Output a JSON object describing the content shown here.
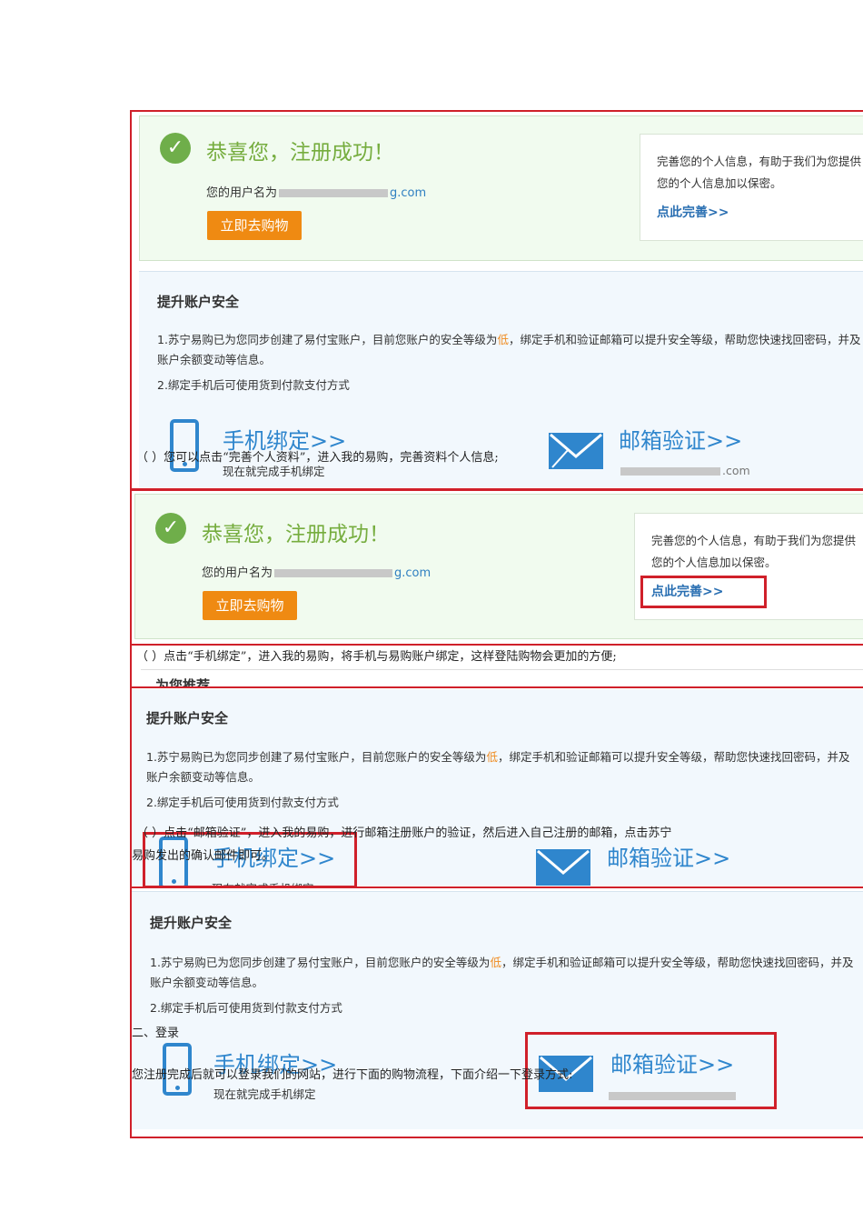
{
  "success": {
    "title": "恭喜您，注册成功！",
    "username_label": "您的用户名为",
    "username_suffix": "g.com",
    "shop_button": "立即去购物",
    "info_line1": "完善您的个人信息，有助于我们为您提供",
    "info_line2": "您的个人信息加以保密。",
    "complete_link": "点此完善>>"
  },
  "security": {
    "heading": "提升账户安全",
    "line1_a": "1.苏宁易购已为您同步创建了易付宝账户，目前您账户的安全等级为",
    "line1_low": "低",
    "line1_b": "，绑定手机和验证邮箱可以提升安全等级，帮助您快速找回密码，并及",
    "line1_cont": "账户余额变动等信息。",
    "line2": "2.绑定手机后可使用货到付款支付方式",
    "phone_bind": "手机绑定>>",
    "phone_sub": "现在就完成手机绑定",
    "email_verify": "邮箱验证>>",
    "email_suffix": ".com"
  },
  "recommend": "为您推荐",
  "doc": {
    "step_profile": "（ ）您可以点击“完善个人资料”，进入我的易购，完善资料个人信息;",
    "step_phone": "（ ）点击“手机绑定”，进入我的易购，将手机与易购账户绑定，这样登陆购物会更加的方便;",
    "step_email_1": "（ ）点击“邮箱验证”，进入我的易购，进行邮箱注册账户的验证，然后进入自己注册的邮箱，点击苏宁",
    "step_email_2": "易购发出的确认邮件即可。",
    "section_login": "二、登录",
    "login_intro": "您注册完成后就可以登录我们的网站，进行下面的购物流程，下面介绍一下登录方式:"
  }
}
